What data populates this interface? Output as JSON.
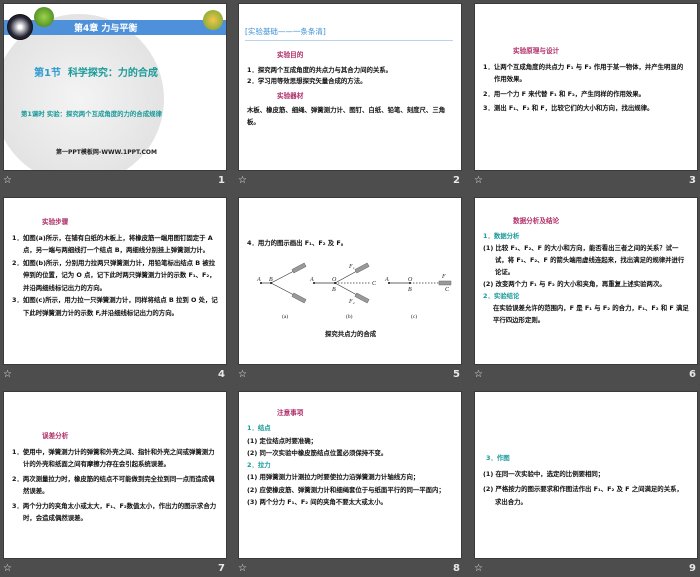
{
  "slides": [
    {
      "number": "1",
      "chapter": "第4章 力与平衡",
      "section": "第1节",
      "section_title": "科学探究：力的合成",
      "lesson": "第1课时 实验：探究两个互成角度的力的合成规律",
      "site": "第一PPT模板网-WWW.1PPT.COM"
    },
    {
      "number": "2",
      "header": "[实验基础——一条条清]",
      "h1": "实验目的",
      "items": [
        "1．探究两个互成角度的共点力与其合力间的关系。",
        "2．学习用等效思想探究矢量合成的方法。"
      ],
      "h2": "实验器材",
      "materials": "木板、橡皮筋、细绳、弹簧测力计、图钉、白纸、铅笔、刻度尺、三角板。"
    },
    {
      "number": "3",
      "h1": "实验原理与设计",
      "items": [
        "1．让两个互成角度的共点力 F₁ 与 F₂ 作用于某一物体，并产生明显的作用效果。",
        "2．用一个力 F 来代替 F₁ 和 F₂，产生同样的作用效果。",
        "3．测出 F₁、F₂ 和 F，比较它们的大小和方向，找出规律。"
      ]
    },
    {
      "number": "4",
      "h1": "实验步骤",
      "items": [
        "1．如图(a)所示，在铺有白纸的木板上，将橡皮筋一端用图钉固定于 A 点，另一端与两细线打一个结点 B，两细线分别挂上弹簧测力计。",
        "2．如图(b)所示，分别用力拉两只弹簧测力计，用铅笔标出结点 B 被拉伸到的位置，记为 O 点，记下此时两只弹簧测力计的示数 F₁、F₂，并沿两细线标记出力的方向。",
        "3．如图(c)所示，用力拉一只弹簧测力计，同样将结点 B 拉到 O 处，记下此时弹簧测力计的示数 F,并沿细线标记出力的方向。"
      ]
    },
    {
      "number": "5",
      "step": "4．用力的图示画出 F₁、F₂ 及 F。",
      "labels": {
        "A": "A",
        "B": "B",
        "O": "O",
        "C": "C",
        "F1": "F₁",
        "F2": "F₂",
        "F": "F"
      },
      "captions": [
        "(a)",
        "(b)",
        "(c)"
      ],
      "figure_title": "探究共点力的合成"
    },
    {
      "number": "6",
      "h1": "数据分析及结论",
      "s1": "1．数据分析",
      "items1": [
        "(1) 比较 F₁、F₂、F 的大小和方向，能否看出三者之间的关系？试一试，将 F₁、F₂、F 的箭头端用虚线连起来，找出满足的规律并进行论证。",
        "(2) 改变两个力 F₁ 与 F₂ 的大小和夹角，再重复上述实验两次。"
      ],
      "s2": "2．实验结论",
      "conclusion": "在实验误差允许的范围内，F 是 F₁ 与 F₂ 的合力，F₁、F₂ 和 F 满足平行四边形定则。"
    },
    {
      "number": "7",
      "h1": "误差分析",
      "items": [
        "1．使用中，弹簧测力计的弹簧和外壳之间、指针和外壳之间或弹簧测力计的外壳和纸面之间有摩擦力存在会引起系统误差。",
        "2．两次测量拉力时，橡皮筋的结点不可能做到完全拉到同一点而造成偶然误差。",
        "3．两个分力的夹角太小或太大，F₁、F₂数值太小，作出力的图示求合力时，会造成偶然误差。"
      ]
    },
    {
      "number": "8",
      "h1": "注意事项",
      "s1": "1．结点",
      "items1": [
        "(1) 定位结点时要准确；",
        "(2) 同一次实验中橡皮筋结点位置必须保持不变。"
      ],
      "s2": "2．拉力",
      "items2": [
        "(1) 用弹簧测力计测拉力时要使拉力沿弹簧测力计轴线方向；",
        "(2) 应使橡皮筋、弹簧测力计和细绳套位于与纸面平行的同一平面内；",
        "(3) 两个分力 F₁、F₂ 间的夹角不要太大或太小。"
      ]
    },
    {
      "number": "9",
      "s1": "3．作图",
      "items": [
        "(1) 在同一次实验中，选定的比例要相同；",
        "(2) 严格按力的图示要求和作图法作出 F₁、F₂ 及 F 之间满足的关系，求出合力。"
      ]
    }
  ],
  "colors": {
    "band": "#4e90d9",
    "heading": "#b0306a",
    "section": "#1a9a9a",
    "background": "#4d4d4d"
  }
}
